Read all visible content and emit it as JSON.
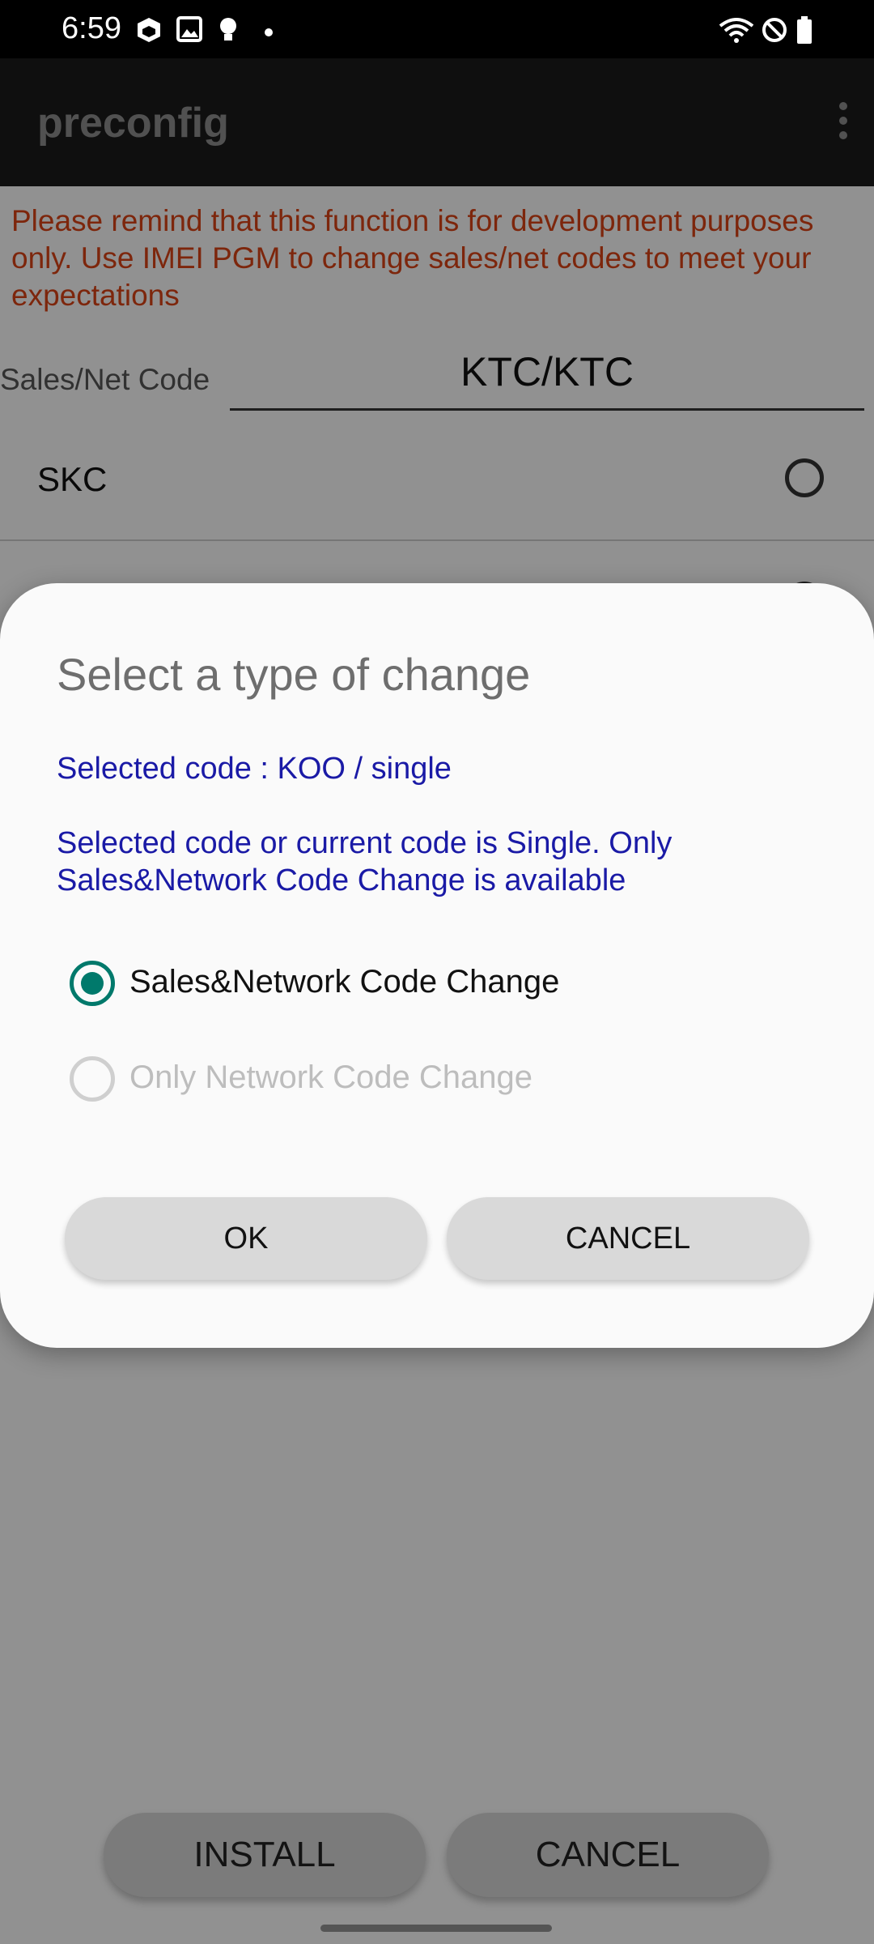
{
  "status_bar": {
    "time": "6:59",
    "left_icons": [
      "box-icon",
      "image-icon",
      "bulb-icon",
      "dot-icon"
    ],
    "right_icons": [
      "wifi-icon",
      "block-icon",
      "battery-icon"
    ]
  },
  "app_bar": {
    "title": "preconfig",
    "menu_icon": "more-vert-icon"
  },
  "main": {
    "warning": "Please remind that this function is for development purposes only. Use IMEI PGM to change sales/net codes to meet your expectations",
    "sales_label": "Sales/Net Code",
    "sales_value": "KTC/KTC",
    "list_items": [
      {
        "label": "SKC",
        "selected": false
      },
      {
        "label": "",
        "selected": false
      }
    ],
    "install_label": "INSTALL",
    "cancel_label": "CANCEL"
  },
  "dialog": {
    "title": "Select a type of change",
    "selected_code": "Selected code : KOO / single",
    "message": "Selected code or current code is Single. Only Sales&Network Code Change is available",
    "options": [
      {
        "label": "Sales&Network Code Change",
        "selected": true,
        "enabled": true
      },
      {
        "label": "Only Network Code Change",
        "selected": false,
        "enabled": false
      }
    ],
    "ok_label": "OK",
    "cancel_label": "CANCEL"
  },
  "colors": {
    "accent": "#00796b",
    "warning": "#d84315",
    "info": "#1a1aa6"
  }
}
